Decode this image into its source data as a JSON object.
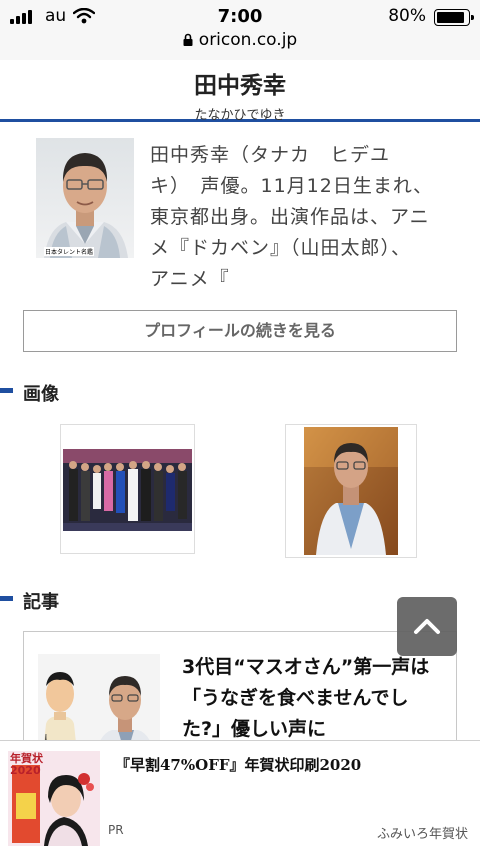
{
  "status": {
    "carrier": "au",
    "time": "7:00",
    "battery": "80%",
    "url": "oricon.co.jp"
  },
  "person": {
    "name": "田中秀幸",
    "kana": "たなかひでゆき",
    "photo_credit": "日本タレント名鑑",
    "profile_lines": [
      "田中秀幸（タナカ　ヒデユ",
      "キ）　声優。11月12日生まれ、",
      "東京都出身。出演作品は、アニ",
      "メ『ドカベン』（山田太郎）、",
      "アニメ『"
    ],
    "more_label": "プロフィールの続きを見る"
  },
  "sections": {
    "images": "画像",
    "articles": "記事"
  },
  "article": {
    "title": "3代目“マスオさん”第一声は「うなぎを食べませんでした?」優しい声に"
  },
  "ad": {
    "title": "『早割47%OFF』年賀状印刷2020",
    "pr": "PR",
    "sponsor": "ふみいろ年賀状",
    "image_text": "年賀状 2020"
  },
  "colors": {
    "accent": "#1f4fa0"
  }
}
